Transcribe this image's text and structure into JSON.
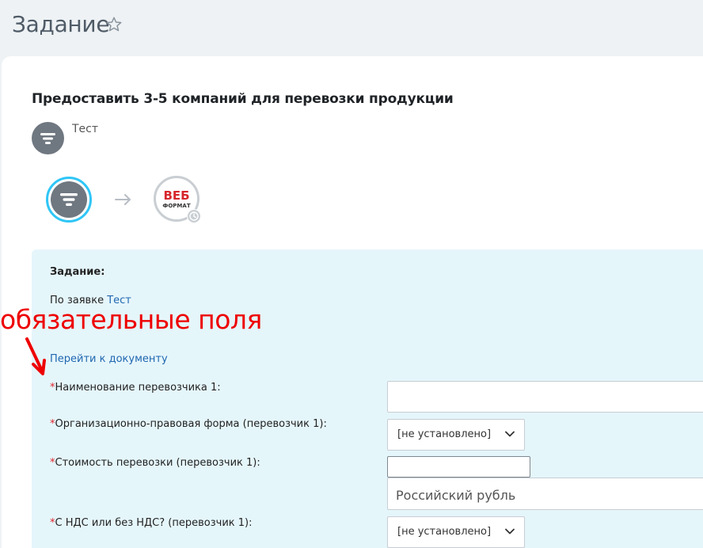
{
  "header": {
    "title": "Задание"
  },
  "task": {
    "title": "Предоставить 3-5 компаний для перевозки продукции",
    "author": "Тест"
  },
  "flow": {
    "to_logo_top": "ВЕБ",
    "to_logo_bottom": "ФОРМАТ"
  },
  "form": {
    "heading": "Задание:",
    "request_prefix": "По заявке",
    "request_link": "Тест",
    "go_to_document": "Перейти к документу",
    "required_mark": "*",
    "fields": [
      {
        "label": "Наименование перевозчика 1:"
      },
      {
        "label": "Организационно-правовая форма (перевозчик 1):",
        "value": "[не установлено]"
      },
      {
        "label": "Стоимость перевозки (перевозчик 1):",
        "currency": "Российский рубль"
      },
      {
        "label": "С НДС или без НДС? (перевозчик 1):",
        "value": "[не установлено]"
      }
    ]
  },
  "annotation": {
    "text": "обязательные поля",
    "color": "#ee0000"
  },
  "colors": {
    "accent": "#2fc6f6",
    "panel": "#e5f6fb",
    "link": "#2067b0",
    "required": "#e0242a"
  }
}
